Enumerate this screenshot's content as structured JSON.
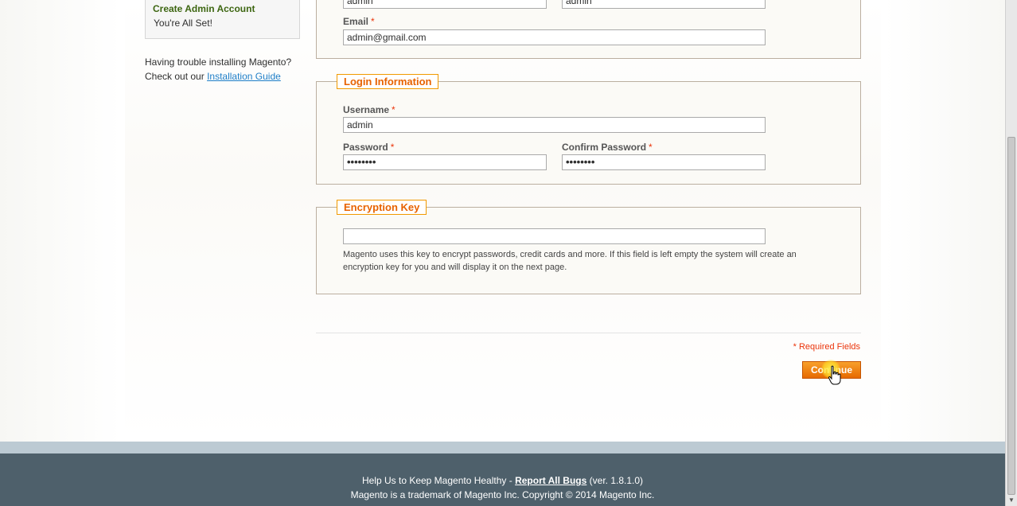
{
  "sidebar": {
    "active_step": "Create Admin Account",
    "done_step": "You're All Set!",
    "trouble_line1": "Having trouble installing Magento?",
    "trouble_prefix": "Check out our",
    "trouble_link": "Installation Guide"
  },
  "personal": {
    "first_name_value": "admin",
    "last_name_value": "admin",
    "email_label": "Email",
    "email_value": "admin@gmail.com"
  },
  "login": {
    "legend": "Login Information",
    "username_label": "Username",
    "username_value": "admin",
    "password_label": "Password",
    "password_value": "••••••••",
    "confirm_label": "Confirm Password",
    "confirm_value": "••••••••"
  },
  "encryption": {
    "legend": "Encryption Key",
    "value": "",
    "note": "Magento uses this key to encrypt passwords, credit cards and more. If this field is left empty the system will create an encryption key for you and will display it on the next page."
  },
  "form": {
    "required_marker": "*",
    "required_note": "* Required Fields",
    "continue_label": "Continue"
  },
  "footer": {
    "help_text": "Help Us to Keep Magento Healthy - ",
    "report_link": "Report All Bugs",
    "version": " (ver. 1.8.1.0)",
    "trademark": "Magento is a trademark of Magento Inc. Copyright © 2014 Magento Inc."
  },
  "colors": {
    "accent_orange": "#e76200",
    "legend_border": "#f19900",
    "active_step_green": "#3d6611",
    "link_blue": "#1e7ec8",
    "footer_bg": "#4e606b",
    "required_red": "#eb340a"
  },
  "icons": {
    "cursor": "hand-pointer-icon"
  }
}
